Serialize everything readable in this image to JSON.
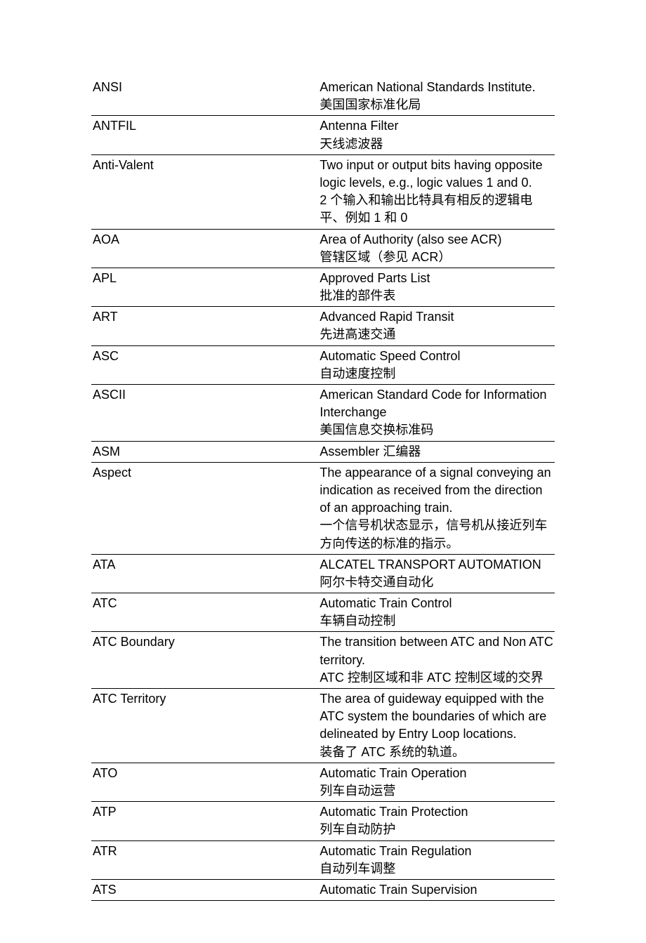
{
  "rows": [
    {
      "term": "ANSI",
      "definitions": [
        "American National Standards Institute.",
        "美国国家标准化局"
      ]
    },
    {
      "term": "ANTFIL",
      "definitions": [
        "Antenna Filter",
        "天线滤波器"
      ]
    },
    {
      "term": "Anti-Valent",
      "definitions": [
        "Two input or output bits having opposite logic levels, e.g., logic values 1 and 0.",
        "2 个输入和输出比特具有相反的逻辑电平、例如 1 和 0"
      ]
    },
    {
      "term": "AOA",
      "definitions": [
        "Area of Authority (also see ACR)",
        "管辖区域（参见 ACR）"
      ]
    },
    {
      "term": "APL",
      "definitions": [
        "Approved Parts List",
        "批准的部件表"
      ]
    },
    {
      "term": "ART",
      "definitions": [
        "Advanced Rapid Transit",
        "先进高速交通"
      ]
    },
    {
      "term": "ASC",
      "definitions": [
        "Automatic Speed Control",
        "自动速度控制"
      ]
    },
    {
      "term": "ASCII",
      "definitions": [
        "American Standard Code for Information Interchange",
        "美国信息交换标准码"
      ]
    },
    {
      "term": "ASM",
      "definitions": [
        "Assembler 汇编器"
      ]
    },
    {
      "term": "Aspect",
      "definitions": [
        "The appearance of a signal conveying an indication as received from the direction of an approaching train.",
        "一个信号机状态显示，信号机从接近列车方向传送的标准的指示。"
      ]
    },
    {
      "term": "ATA",
      "definitions": [
        "ALCATEL TRANSPORT AUTOMATION",
        "阿尔卡特交通自动化"
      ]
    },
    {
      "term": "ATC",
      "definitions": [
        "Automatic Train Control",
        "车辆自动控制"
      ]
    },
    {
      "term": "ATC Boundary",
      "definitions": [
        "The transition between ATC and Non ATC territory.",
        "ATC 控制区域和非 ATC 控制区域的交界"
      ]
    },
    {
      "term": "ATC Territory",
      "definitions": [
        "The area of guideway equipped with the ATC system the boundaries of which are delineated by Entry Loop locations.",
        "装备了 ATC 系统的轨道。"
      ]
    },
    {
      "term": "ATO",
      "definitions": [
        "Automatic Train Operation",
        "列车自动运营"
      ]
    },
    {
      "term": "ATP",
      "definitions": [
        "Automatic Train Protection",
        "列车自动防护"
      ]
    },
    {
      "term": "ATR",
      "definitions": [
        "Automatic Train Regulation",
        "自动列车调整"
      ]
    },
    {
      "term": "ATS",
      "definitions": [
        "Automatic Train Supervision"
      ]
    }
  ]
}
